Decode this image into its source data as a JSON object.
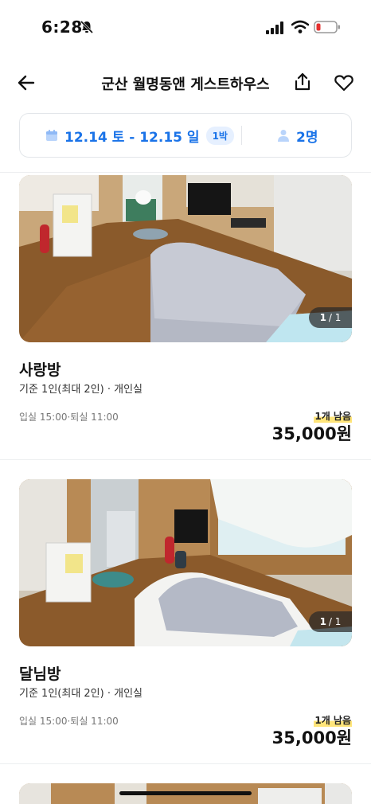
{
  "status_bar": {
    "time": "6:28"
  },
  "header": {
    "title": "군산 월명동앤 게스트하우스"
  },
  "filter": {
    "dates": "12.14 토 - 12.15 일",
    "nights": "1박",
    "guests": "2명"
  },
  "rooms": [
    {
      "name": "사랑방",
      "description": "기준 1인(최대 2인) · 개인실",
      "checkin": "입실 15:00·퇴실 11:00",
      "remaining": "1개 남음",
      "price": "35,000원",
      "photo_current": "1",
      "photo_total": "/ 1"
    },
    {
      "name": "달님방",
      "description": "기준 1인(최대 2인) · 개인실",
      "checkin": "입실 15:00·퇴실 11:00",
      "remaining": "1개 남음",
      "price": "35,000원",
      "photo_current": "1",
      "photo_total": "/ 1"
    }
  ],
  "colors": {
    "accent": "#1a73e8",
    "badge_bg": "#e6f0ff",
    "highlight": "#ffe57a"
  }
}
